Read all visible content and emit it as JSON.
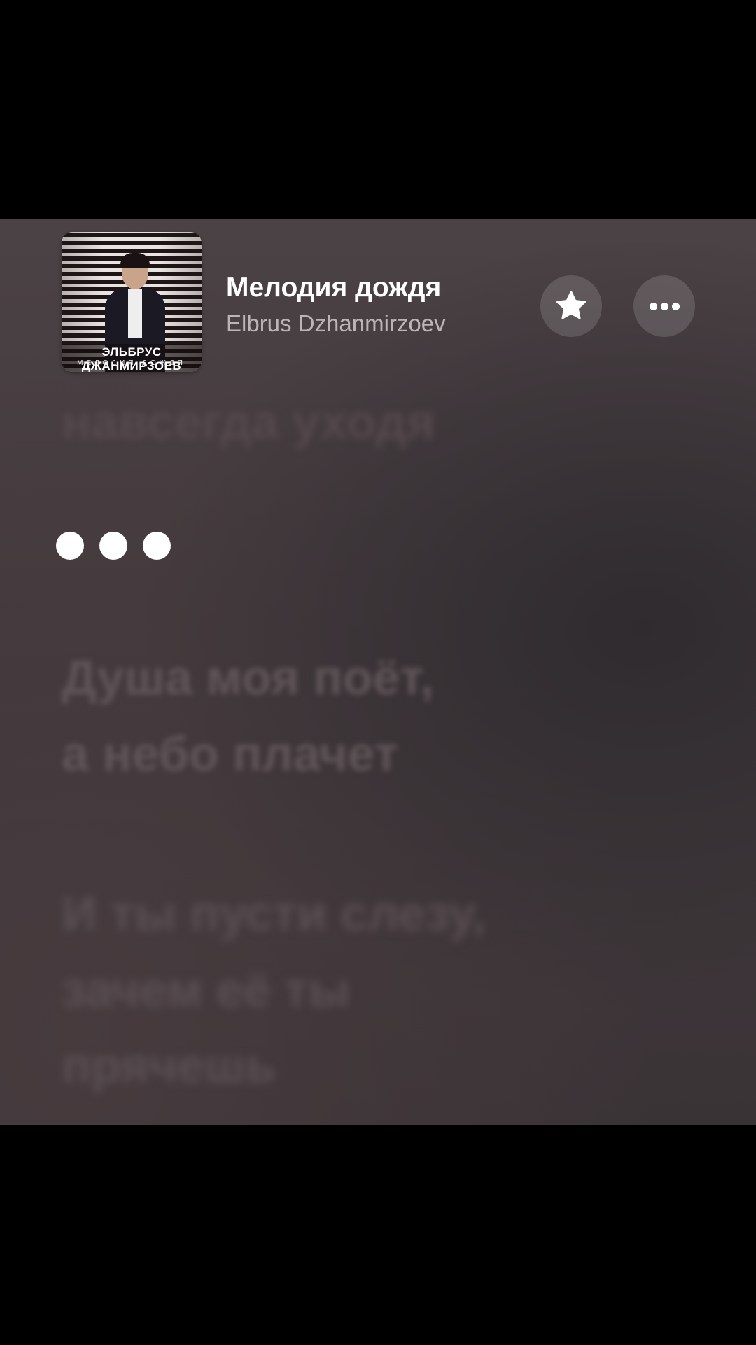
{
  "now_playing": {
    "title": "Мелодия дождя",
    "artist": "Elbrus Dzhanmirzoev",
    "cover_text_title": "ЭЛЬБРУС ДЖАНМИРЗОЕВ",
    "cover_text_subtitle": "МЕЛОДИЯ ДОЖДЯ"
  },
  "actions": {
    "favorite_icon": "star-icon",
    "more_icon": "ellipsis-icon"
  },
  "lyrics": {
    "previous_line": "навсегда уходя",
    "lines": [
      [
        "Душа моя поёт,",
        "а небо плачет"
      ],
      [
        "И ты пусти слезу,",
        "зачем её ты",
        "прячешь"
      ]
    ]
  },
  "colors": {
    "background": "#443b3e",
    "title": "#ffffff",
    "artist": "#bdb4b6"
  }
}
